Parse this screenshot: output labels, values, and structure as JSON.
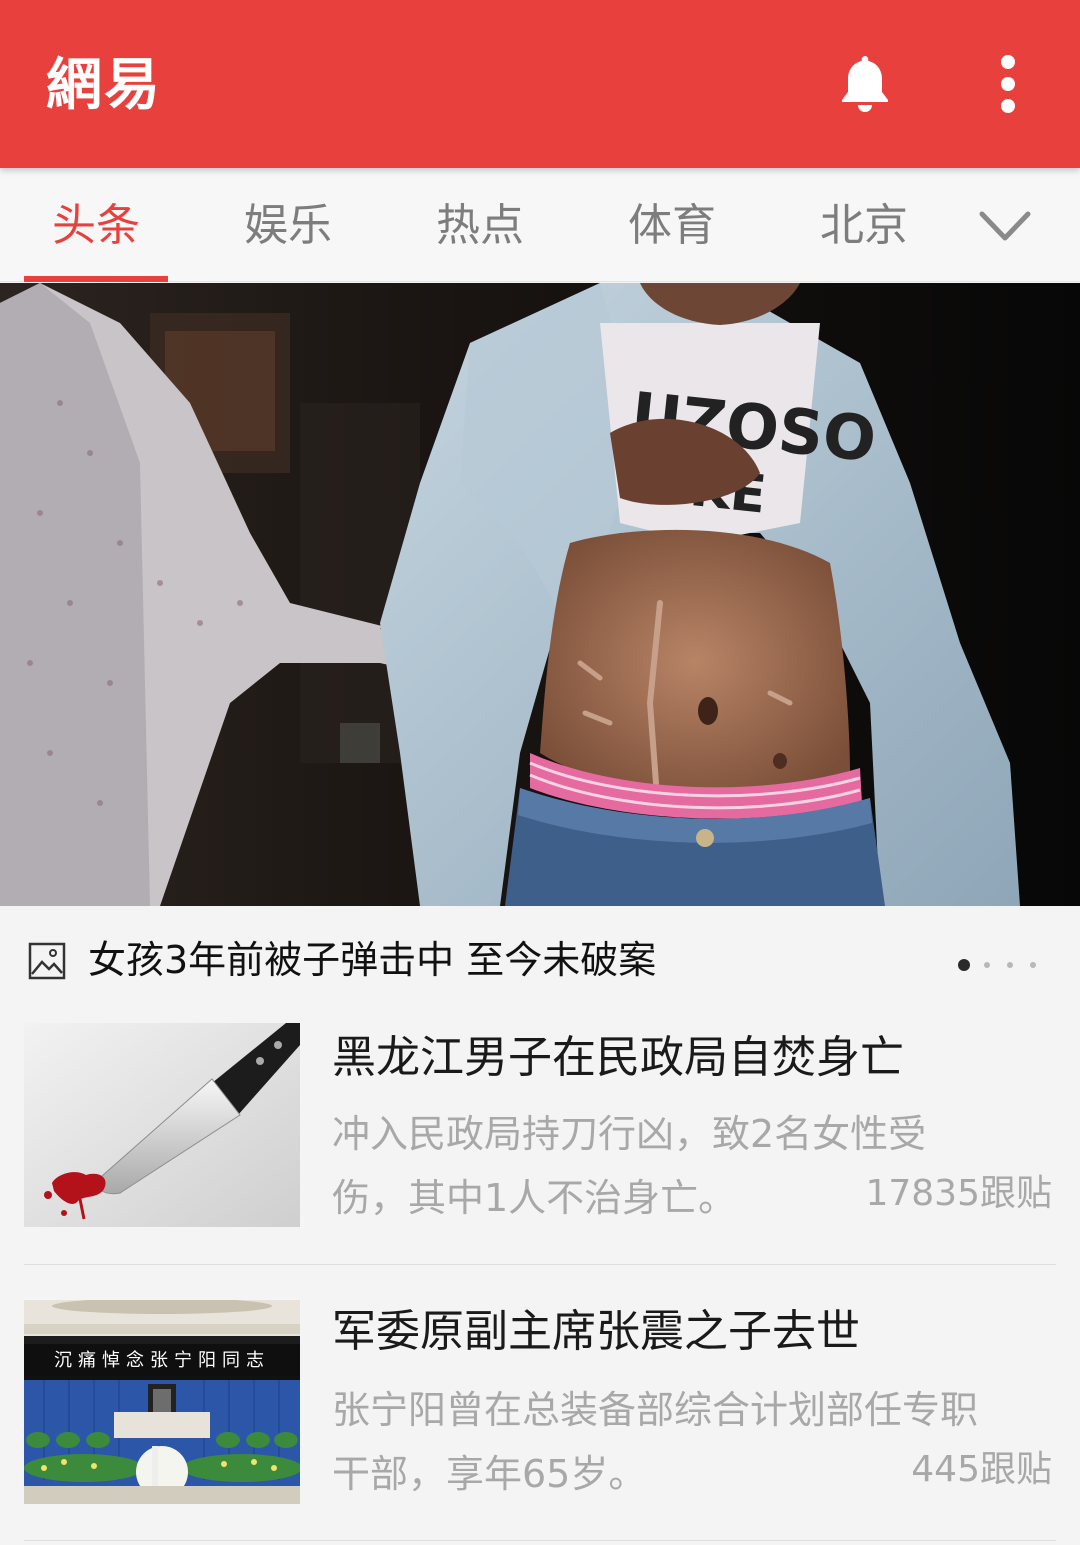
{
  "app_bar": {
    "brand": "網易",
    "background": "#e8403c",
    "icons": [
      "bell-icon",
      "more-vertical-icon"
    ]
  },
  "tabs": {
    "items": [
      {
        "label": "头条",
        "active": true
      },
      {
        "label": "娱乐",
        "active": false
      },
      {
        "label": "热点",
        "active": false
      },
      {
        "label": "体育",
        "active": false
      },
      {
        "label": "北京",
        "active": false
      }
    ],
    "accent": "#e8403c",
    "expand_icon": "chevron-down-icon"
  },
  "hero": {
    "icon": "image-gallery-icon",
    "title": "女孩3年前被子弹击中 至今未破案",
    "pager": {
      "total": 4,
      "current": 1
    }
  },
  "news": [
    {
      "title": "黑龙江男子在民政局自焚身亡",
      "summary_line1": "冲入民政局持刀行凶，致2名女性受",
      "summary_line2": "伤，其中1人不治身亡。",
      "comments": "17835跟贴"
    },
    {
      "title": "军委原副主席张震之子去世",
      "summary_line1": "张宁阳曾在总装备部综合计划部任专职",
      "summary_line2": "干部，享年65岁。",
      "comments": "445跟贴",
      "thumb_banner": "沉痛悼念张宁阳同志"
    }
  ]
}
